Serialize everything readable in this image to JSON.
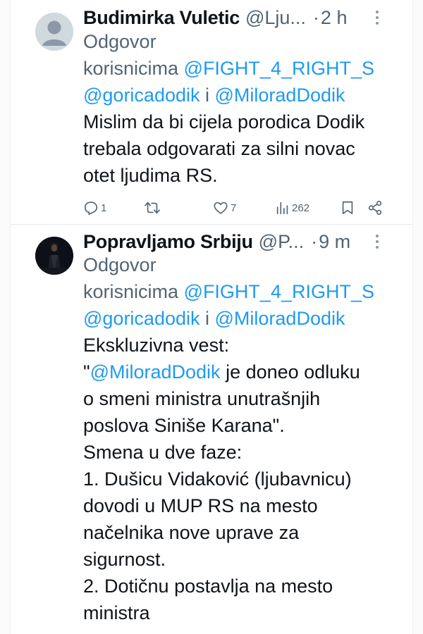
{
  "tweets": [
    {
      "name": "Budimirka Vuletic",
      "handle": "@Lju...",
      "dot": "·",
      "time": "2 h",
      "reply_prefix": "Odgovor",
      "reply_line2_prefix": "korisnicima ",
      "reply_mention_1": "@FIGHT_4_RIGHT_S",
      "reply_mention_2": "@goricadodik",
      "reply_and": " i ",
      "reply_mention_3": "@MiloradDodik",
      "text_lines": [
        "Mislim da bi cijela porodica Dodik",
        "trebala odgovarati za silni novac",
        "otet ljudima RS."
      ],
      "replies": "1",
      "likes": "7",
      "views": "262",
      "icons": [
        "reply-icon",
        "retweet-icon",
        "like-icon",
        "views-icon",
        "bookmark-icon",
        "share-icon",
        "more-icon"
      ]
    },
    {
      "name": "Popravljamo Srbiju",
      "handle": "@P...",
      "dot": "·",
      "time": "9 m",
      "reply_prefix": "Odgovor",
      "reply_line2_prefix": "korisnicima ",
      "reply_mention_1": "@FIGHT_4_RIGHT_S",
      "reply_mention_2": "@goricadodik",
      "reply_and": " i ",
      "reply_mention_3": "@MiloradDodik",
      "text_intro": "Ekskluzivna vest:",
      "quote_open": "\"",
      "quote_mention": "@MiloradDodik",
      "quote_rest": " je doneo odluku",
      "text_lines": [
        "o smeni ministra unutrašnjih",
        "poslova Siniše Karana\".",
        "Smena u dve faze:",
        "1. Dušicu Vidaković (ljubavnicu)",
        "dovodi u MUP RS na mesto",
        "načelnika nove uprave za",
        "sigurnost.",
        "2. Dotičnu postavlja na mesto",
        "ministra"
      ]
    }
  ],
  "colors": {
    "text": "#0f1419",
    "muted": "#536471",
    "link": "#1d9bf0",
    "divider": "#e6e8ea"
  }
}
